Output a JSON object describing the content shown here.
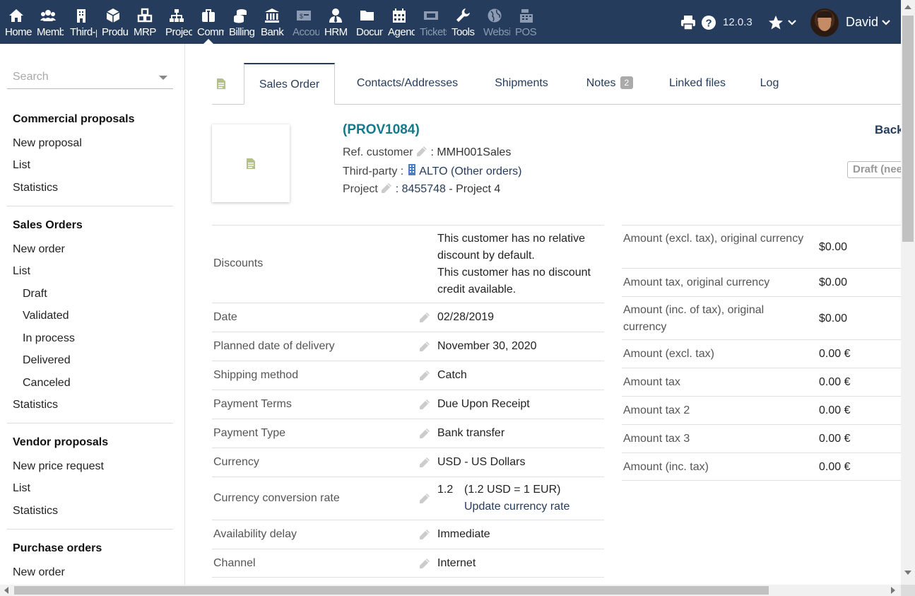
{
  "topbar": {
    "menu": [
      {
        "label": "Home",
        "icon": "home-icon"
      },
      {
        "label": "Members",
        "icon": "members-icon"
      },
      {
        "label": "Third-parties",
        "icon": "building-icon"
      },
      {
        "label": "Products",
        "icon": "box-icon"
      },
      {
        "label": "MRP",
        "icon": "cubes-icon"
      },
      {
        "label": "Projects",
        "icon": "sitemap-icon"
      },
      {
        "label": "Commercial",
        "icon": "briefcase-icon"
      },
      {
        "label": "Billing",
        "icon": "coins-icon"
      },
      {
        "label": "Bank",
        "icon": "bank-icon"
      },
      {
        "label": "Accounting",
        "icon": "money-icon"
      },
      {
        "label": "HRM",
        "icon": "user-tie-icon"
      },
      {
        "label": "Documents",
        "icon": "folder-icon"
      },
      {
        "label": "Agenda",
        "icon": "calendar-icon"
      },
      {
        "label": "Tickets",
        "icon": "ticket-icon"
      },
      {
        "label": "Tools",
        "icon": "wrench-icon"
      },
      {
        "label": "Websites",
        "icon": "globe-icon"
      },
      {
        "label": "POS",
        "icon": "cash-register-icon"
      }
    ],
    "version": "12.0.3",
    "user_name": "David"
  },
  "sidebar": {
    "search_placeholder": "Search",
    "sections": [
      {
        "title": "Commercial proposals",
        "links": [
          "New proposal",
          "List",
          "Statistics"
        ]
      },
      {
        "title": "Sales Orders",
        "links": [
          "New order",
          "List",
          "Draft",
          "Validated",
          "In process",
          "Delivered",
          "Canceled",
          "Statistics"
        ]
      },
      {
        "title": "Vendor proposals",
        "links": [
          "New price request",
          "List",
          "Statistics"
        ]
      },
      {
        "title": "Purchase orders",
        "links": [
          "New order"
        ]
      }
    ]
  },
  "tabs": [
    {
      "label": "Sales Order"
    },
    {
      "label": "Contacts/Addresses"
    },
    {
      "label": "Shipments"
    },
    {
      "label": "Notes",
      "badge": "2"
    },
    {
      "label": "Linked files"
    },
    {
      "label": "Log"
    }
  ],
  "header": {
    "ref": "(PROV1084)",
    "ref_customer_label": "Ref. customer",
    "ref_customer_value": ": MMH001Sales",
    "third_party_label": "Third-party :",
    "third_party_name": "ALTO",
    "third_party_other": "(Other orders)",
    "project_label": "Project",
    "project_code": ": 8455748",
    "project_name": "- Project 4",
    "back_link": "Back to list",
    "status": "Draft (needs to be validated)"
  },
  "fields": [
    {
      "label": "Discounts",
      "value": "This customer has no relative discount by default.",
      "value2": "This customer has no discount credit available."
    },
    {
      "label": "Date",
      "value": "02/28/2019"
    },
    {
      "label": "Planned date of delivery",
      "value": "November 30, 2020"
    },
    {
      "label": "Shipping method",
      "value": "Catch"
    },
    {
      "label": "Payment Terms",
      "value": "Due Upon Receipt"
    },
    {
      "label": "Payment Type",
      "value": "Bank transfer"
    },
    {
      "label": "Currency",
      "value": "USD - US Dollars"
    },
    {
      "label": "Currency conversion rate",
      "value": "1.2",
      "value_extra": "(1.2 USD = 1 EUR)",
      "link": "Update currency rate"
    },
    {
      "label": "Availability delay",
      "value": "Immediate"
    },
    {
      "label": "Channel",
      "value": "Internet"
    }
  ],
  "amounts": [
    {
      "label": "Amount (excl. tax), original currency",
      "value": "$0.00"
    },
    {
      "label": "Amount tax, original currency",
      "value": "$0.00"
    },
    {
      "label": "Amount (inc. of tax), original currency",
      "value": "$0.00"
    },
    {
      "label": "Amount (excl. tax)",
      "value": "0.00 €"
    },
    {
      "label": "Amount tax",
      "value": "0.00 €"
    },
    {
      "label": "Amount tax 2",
      "value": "0.00 €"
    },
    {
      "label": "Amount tax 3",
      "value": "0.00 €"
    },
    {
      "label": "Amount (inc. tax)",
      "value": "0.00 €"
    }
  ],
  "colors": {
    "topbar": "#263c5c",
    "ref": "#137a8a",
    "link": "#263c5c"
  }
}
